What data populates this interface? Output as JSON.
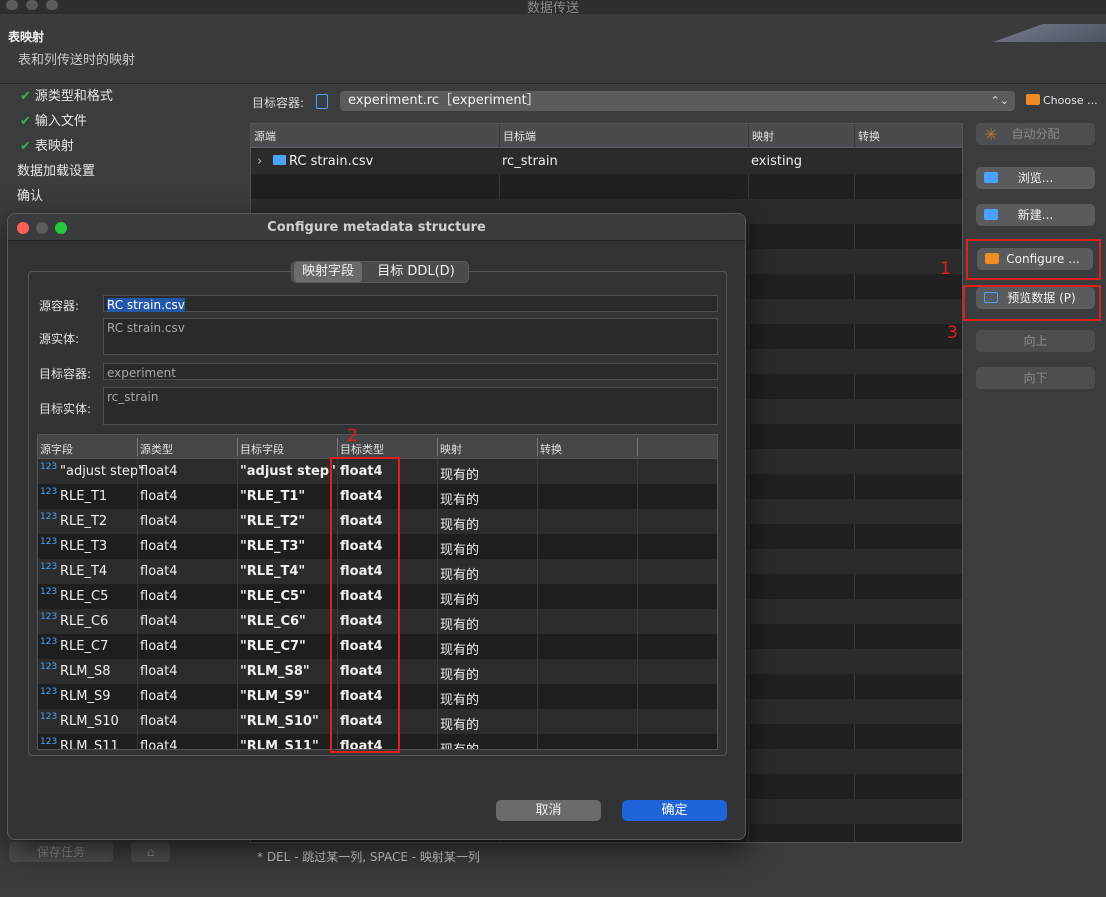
{
  "window": {
    "title": "数据传送"
  },
  "header": {
    "title": "表映射",
    "subtitle": "表和列传送时的映射"
  },
  "steps": [
    {
      "label": "源类型和格式",
      "done": true
    },
    {
      "label": "输入文件",
      "done": true
    },
    {
      "label": "表映射",
      "done": true
    },
    {
      "label": "数据加载设置",
      "done": false
    },
    {
      "label": "确认",
      "done": false
    }
  ],
  "target": {
    "label": "目标容器:",
    "value": "experiment.rc［experiment］",
    "choose_label": "Choose ..."
  },
  "mapping_table": {
    "columns": [
      "源端",
      "目标端",
      "映射",
      "转换"
    ],
    "rows": [
      {
        "source": "RC strain.csv",
        "target": "rc_strain",
        "mapping": "existing",
        "transform": ""
      }
    ]
  },
  "right_buttons": {
    "auto_assign": "自动分配",
    "browse": "浏览...",
    "new": "新建...",
    "configure": "Configure ...",
    "preview": "预览数据 (P)",
    "up": "向上",
    "down": "向下"
  },
  "annotations": {
    "n1": "1",
    "n2": "2",
    "n3": "3"
  },
  "bottom": {
    "save_task": "保存任务",
    "note": "* DEL - 跳过某一列, SPACE - 映射某一列"
  },
  "dialog": {
    "title": "Configure metadata structure",
    "tabs": [
      "映射字段",
      "目标 DDL(D)"
    ],
    "fields": {
      "source_container_label": "源容器:",
      "source_container_value": "RC strain.csv",
      "source_entity_label": "源实体:",
      "source_entity_value": "RC strain.csv",
      "target_container_label": "目标容器:",
      "target_container_value": "experiment",
      "target_entity_label": "目标实体:",
      "target_entity_value": "rc_strain"
    },
    "grid": {
      "columns": [
        "源字段",
        "源类型",
        "目标字段",
        "目标类型",
        "映射",
        "转换"
      ],
      "icon_text": "123",
      "rows": [
        {
          "src": "\"adjust step\"",
          "src_type": "float4",
          "tgt": "\"adjust step\"",
          "tgt_type": "float4",
          "map": "现有的"
        },
        {
          "src": "RLE_T1",
          "src_type": "float4",
          "tgt": "\"RLE_T1\"",
          "tgt_type": "float4",
          "map": "现有的"
        },
        {
          "src": "RLE_T2",
          "src_type": "float4",
          "tgt": "\"RLE_T2\"",
          "tgt_type": "float4",
          "map": "现有的"
        },
        {
          "src": "RLE_T3",
          "src_type": "float4",
          "tgt": "\"RLE_T3\"",
          "tgt_type": "float4",
          "map": "现有的"
        },
        {
          "src": "RLE_T4",
          "src_type": "float4",
          "tgt": "\"RLE_T4\"",
          "tgt_type": "float4",
          "map": "现有的"
        },
        {
          "src": "RLE_C5",
          "src_type": "float4",
          "tgt": "\"RLE_C5\"",
          "tgt_type": "float4",
          "map": "现有的"
        },
        {
          "src": "RLE_C6",
          "src_type": "float4",
          "tgt": "\"RLE_C6\"",
          "tgt_type": "float4",
          "map": "现有的"
        },
        {
          "src": "RLE_C7",
          "src_type": "float4",
          "tgt": "\"RLE_C7\"",
          "tgt_type": "float4",
          "map": "现有的"
        },
        {
          "src": "RLM_S8",
          "src_type": "float4",
          "tgt": "\"RLM_S8\"",
          "tgt_type": "float4",
          "map": "现有的"
        },
        {
          "src": "RLM_S9",
          "src_type": "float4",
          "tgt": "\"RLM_S9\"",
          "tgt_type": "float4",
          "map": "现有的"
        },
        {
          "src": "RLM_S10",
          "src_type": "float4",
          "tgt": "\"RLM_S10\"",
          "tgt_type": "float4",
          "map": "现有的"
        },
        {
          "src": "RLM_S11",
          "src_type": "float4",
          "tgt": "\"RLM_S11\"",
          "tgt_type": "float4",
          "map": "现有的"
        }
      ]
    },
    "buttons": {
      "cancel": "取消",
      "ok": "确定"
    }
  },
  "colors": {
    "accent": "#1f63d9",
    "highlight": "#e02020",
    "check": "#37b24d"
  }
}
